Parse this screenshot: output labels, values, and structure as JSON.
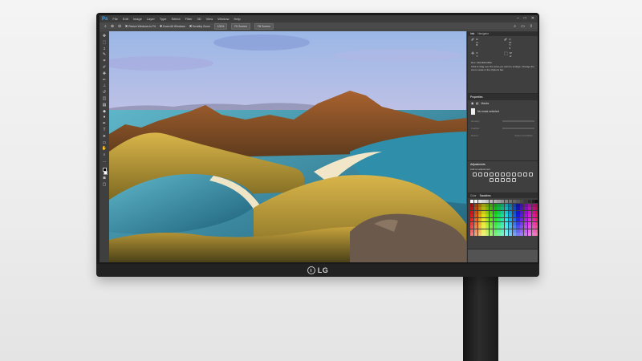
{
  "brand": {
    "logo_text": "LG"
  },
  "app": {
    "logo": "Ps",
    "menu": [
      "File",
      "Edit",
      "Image",
      "Layer",
      "Type",
      "Select",
      "Filter",
      "3D",
      "View",
      "Window",
      "Help"
    ],
    "window_controls": [
      "minimize-icon",
      "maximize-icon",
      "close-icon"
    ]
  },
  "options": {
    "resize_windows": "Resize Windows to Fit",
    "zoom_all": "Zoom All Windows",
    "scrubby_zoom": "Scrubby Zoom",
    "zoom_level": "100%",
    "fit_screen": "Fit Screen",
    "fill_screen": "Fill Screen"
  },
  "panels": {
    "info": {
      "tabs": [
        "Info",
        "Navigator"
      ],
      "cells": [
        {
          "icon": "eyedropper-icon",
          "lines": [
            "R:",
            "G:",
            "B:"
          ]
        },
        {
          "icon": "eyedropper-icon",
          "lines": [
            "C:",
            "M:",
            "Y:",
            "K:"
          ]
        },
        {
          "icon": "crosshair-icon",
          "lines": [
            "X:",
            "Y:"
          ]
        },
        {
          "icon": "selection-icon",
          "lines": [
            "W:",
            "H:"
          ]
        }
      ],
      "doc": "Doc: 166.9M/2.86G",
      "hint": "Click & drag over the area you want to enlarge. Change the zoom mode in the Options bar."
    },
    "properties": {
      "title": "Properties",
      "masks_label": "Masks",
      "no_mask": "No mask selected",
      "density": "Density:",
      "feather": "Feather:",
      "refine": "Refine:",
      "select_focus": "Select and Mask..."
    },
    "adjustments": {
      "title": "Adjustments",
      "subtitle": "Add an adjustment"
    },
    "swatches": {
      "tabs": [
        "Color",
        "Swatches"
      ]
    }
  }
}
